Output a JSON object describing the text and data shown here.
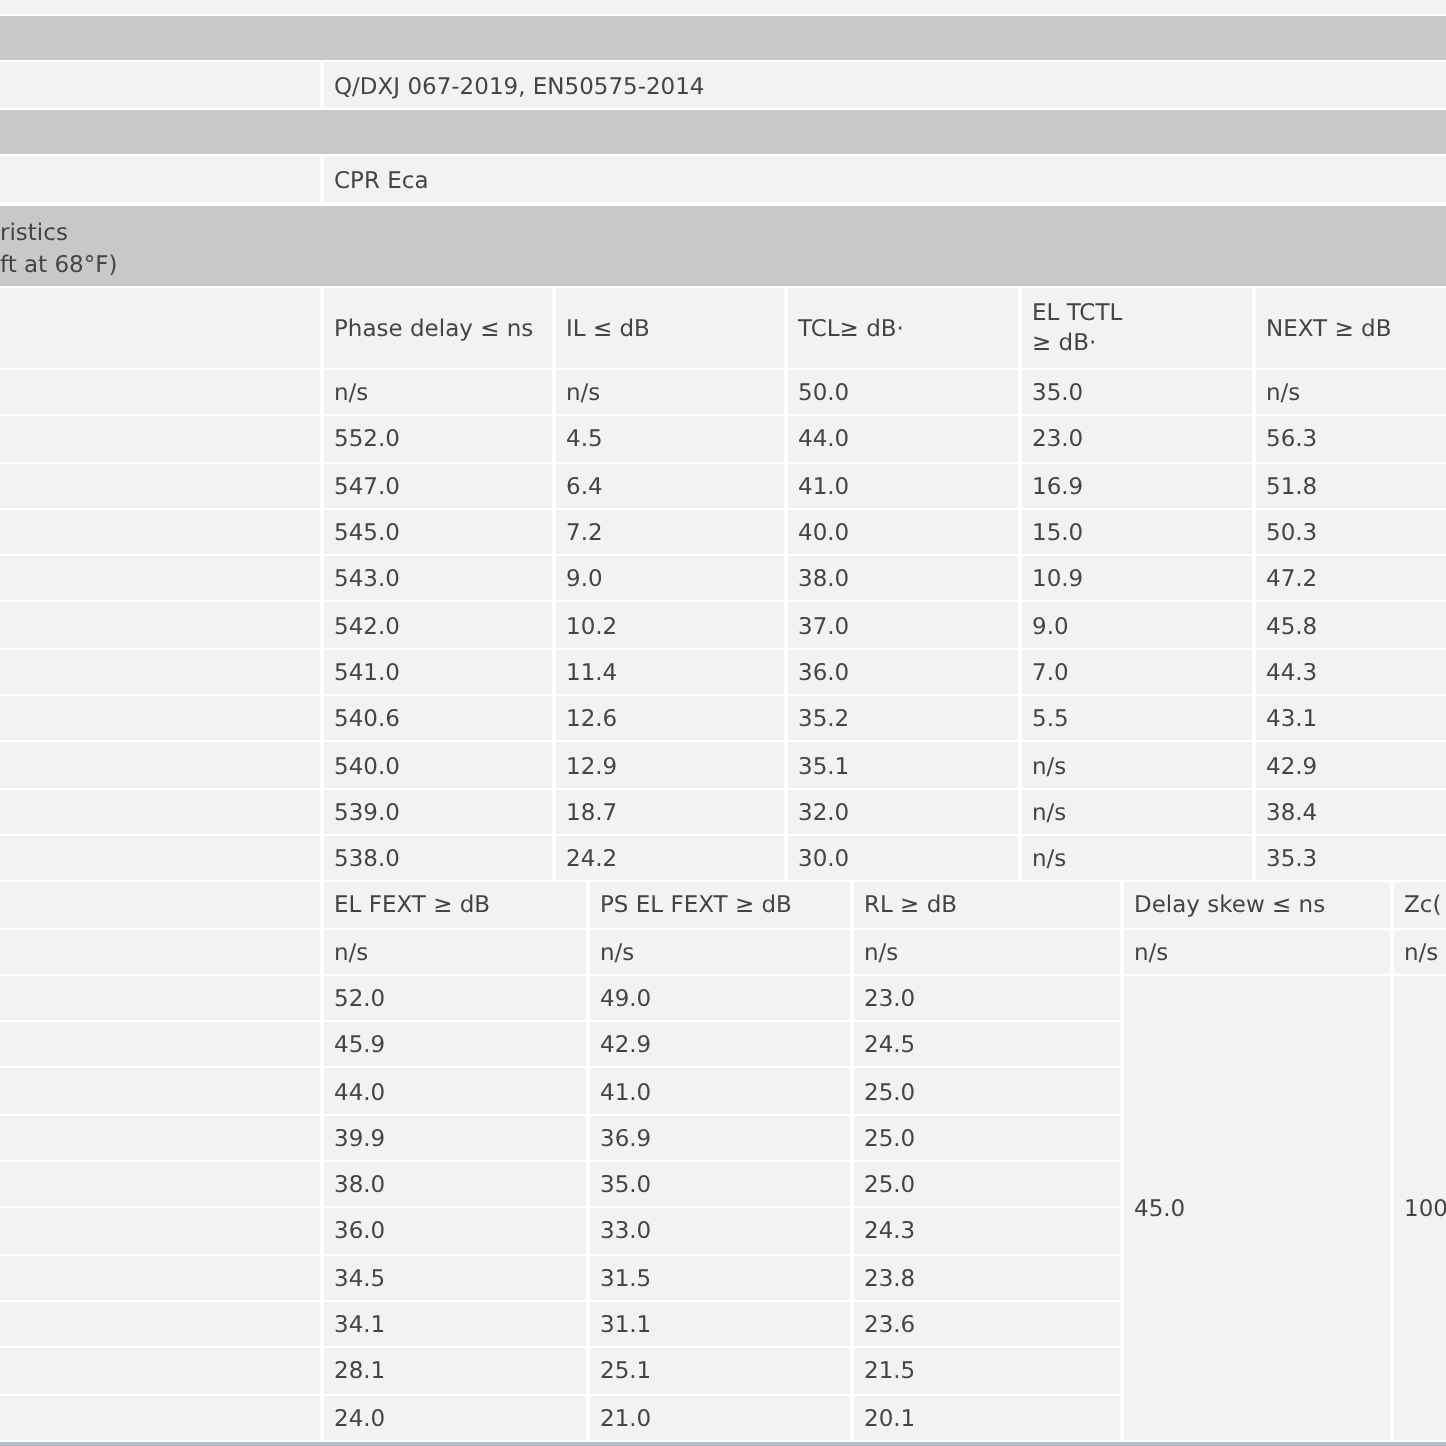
{
  "spec_rows": [
    {
      "kind": "partial"
    },
    {
      "kind": "section"
    },
    {
      "kind": "value",
      "value": "Q/DXJ 067-2019, EN50575-2014"
    },
    {
      "kind": "section"
    },
    {
      "kind": "value",
      "value": "CPR Eca"
    },
    {
      "kind": "section",
      "label_lines": [
        "ristics",
        "ft at 68°F)"
      ]
    }
  ],
  "table_1": {
    "columns": [
      "Phase delay ≤ ns",
      "IL ≤ dB",
      "TCL≥ dB·",
      "EL TCTL\n≥ dB·",
      "NEXT ≥ dB"
    ],
    "rows": [
      [
        "n/s",
        "n/s",
        "50.0",
        "35.0",
        "n/s"
      ],
      [
        "552.0",
        "4.5",
        "44.0",
        "23.0",
        "56.3"
      ],
      [
        "547.0",
        "6.4",
        "41.0",
        "16.9",
        "51.8"
      ],
      [
        "545.0",
        "7.2",
        "40.0",
        "15.0",
        "50.3"
      ],
      [
        "543.0",
        "9.0",
        "38.0",
        "10.9",
        "47.2"
      ],
      [
        "542.0",
        "10.2",
        "37.0",
        "9.0",
        "45.8"
      ],
      [
        "541.0",
        "11.4",
        "36.0",
        "7.0",
        "44.3"
      ],
      [
        "540.6",
        "12.6",
        "35.2",
        "5.5",
        "43.1"
      ],
      [
        "540.0",
        "12.9",
        "35.1",
        "n/s",
        "42.9"
      ],
      [
        "539.0",
        "18.7",
        "32.0",
        "n/s",
        "38.4"
      ],
      [
        "538.0",
        "24.2",
        "30.0",
        "n/s",
        "35.3"
      ]
    ]
  },
  "table_2": {
    "columns": [
      "EL FEXT ≥ dB",
      "PS EL FEXT ≥ dB",
      "RL ≥ dB",
      "Delay skew ≤ ns",
      "Zc("
    ],
    "first_row": [
      "n/s",
      "n/s",
      "n/s",
      "n/s",
      "n/s"
    ],
    "rows": [
      [
        "52.0",
        "49.0",
        "23.0"
      ],
      [
        "45.9",
        "42.9",
        "24.5"
      ],
      [
        "44.0",
        "41.0",
        "25.0"
      ],
      [
        "39.9",
        "36.9",
        "25.0"
      ],
      [
        "38.0",
        "35.0",
        "25.0"
      ],
      [
        "36.0",
        "33.0",
        "24.3"
      ],
      [
        "34.5",
        "31.5",
        "23.8"
      ],
      [
        "34.1",
        "31.1",
        "23.6"
      ],
      [
        "28.1",
        "25.1",
        "21.5"
      ],
      [
        "24.0",
        "21.0",
        "20.1"
      ]
    ],
    "merged": [
      "45.0",
      "100"
    ]
  }
}
